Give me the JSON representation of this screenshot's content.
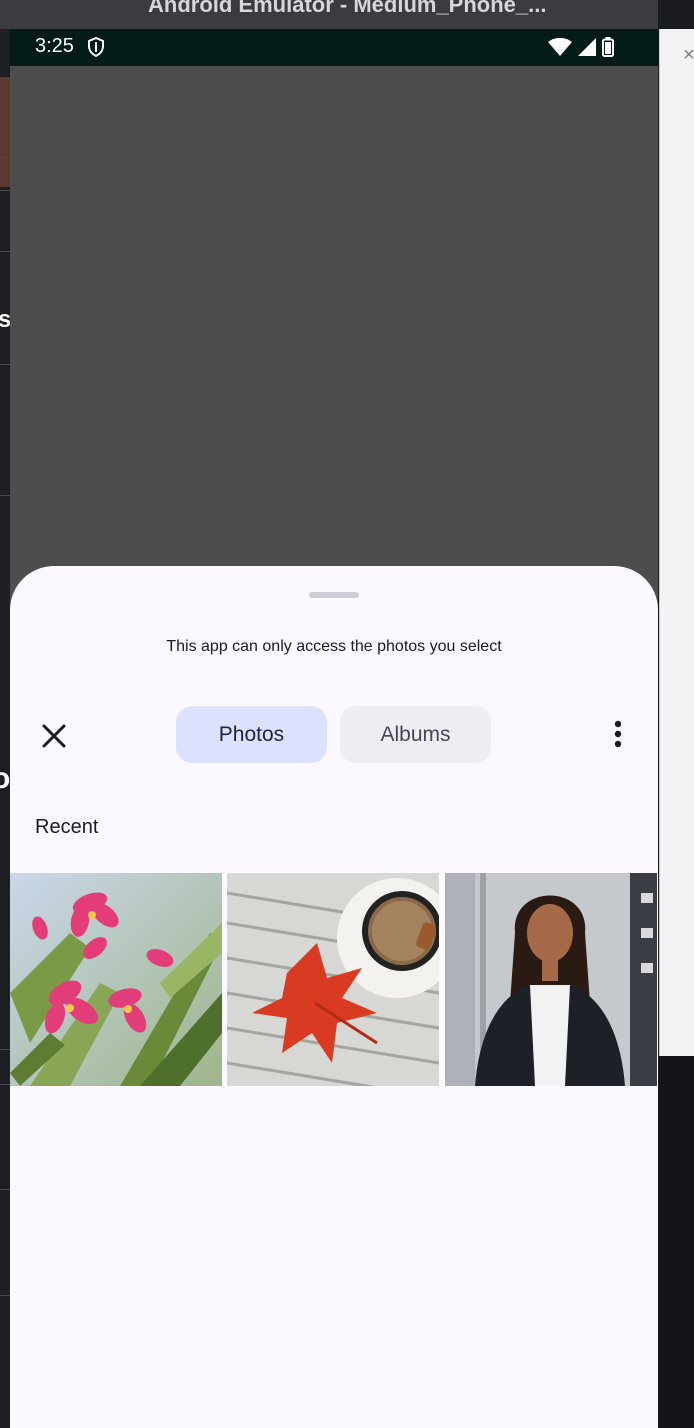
{
  "host": {
    "window_title": "Android Emulator - Medium_Phone_...",
    "close_glyph": "×",
    "left_fragment_1": "s",
    "left_fragment_2": "o"
  },
  "statusbar": {
    "time": "3:25",
    "icons": [
      "shield-icon",
      "wifi-icon",
      "cell-signal-icon",
      "battery-icon"
    ]
  },
  "sheet": {
    "notice": "This app can only access the photos you select",
    "tabs": [
      {
        "label": "Photos",
        "selected": true
      },
      {
        "label": "Albums",
        "selected": false
      }
    ],
    "section_title": "Recent",
    "photos": [
      {
        "subject": "pink-plumeria-flowers"
      },
      {
        "subject": "coffee-cup-with-red-leaf"
      },
      {
        "subject": "woman-in-blazer-portrait"
      }
    ]
  },
  "colors": {
    "accent_selected_tab": "#dce1ff",
    "sheet_background": "#fbf8ff",
    "statusbar": "#041c18",
    "scrim": "#4d4d4d"
  }
}
